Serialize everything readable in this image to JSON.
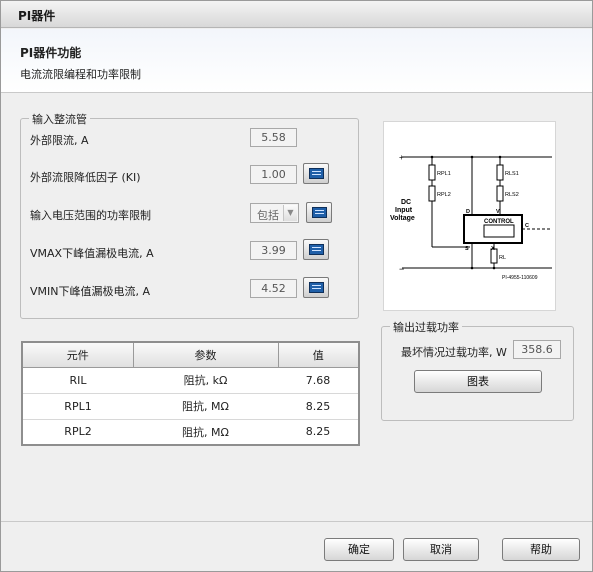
{
  "window": {
    "title": "PI器件"
  },
  "header": {
    "title": "PI器件功能",
    "subtitle": "电流流限编程和功率限制"
  },
  "input_group": {
    "legend": "输入整流管",
    "rows": [
      {
        "label": "外部限流, A",
        "value": "5.58"
      },
      {
        "label": "外部流限降低因子 (KI)",
        "value": "1.00"
      },
      {
        "label": "输入电压范围的功率限制",
        "select_value": "包括"
      },
      {
        "label": "VMAX下峰值漏极电流, A",
        "value": "3.99"
      },
      {
        "label": "VMIN下峰值漏极电流, A",
        "value": "4.52"
      }
    ]
  },
  "table": {
    "headers": [
      "元件",
      "参数",
      "值"
    ],
    "rows": [
      [
        "RIL",
        "阻抗, kΩ",
        "7.68"
      ],
      [
        "RPL1",
        "阻抗, MΩ",
        "8.25"
      ],
      [
        "RPL2",
        "阻抗, MΩ",
        "8.25"
      ]
    ]
  },
  "diagram": {
    "labels": {
      "dc": "DC",
      "input": "Input",
      "voltage": "Voltage",
      "plus": "+",
      "minus": "−",
      "rpl1": "RPL1",
      "rpl2": "RPL2",
      "rls1": "RLS1",
      "rls2": "RLS2",
      "rl": "RL",
      "d": "D",
      "v": "V",
      "c": "C",
      "s": "S",
      "x": "X",
      "control": "CONTROL",
      "code": "PI-4955-110609"
    }
  },
  "output_group": {
    "legend": "输出过载功率",
    "label": "最坏情况过载功率, W",
    "value": "358.6",
    "chart_button": "图表"
  },
  "footer": {
    "ok": "确定",
    "cancel": "取消",
    "help": "帮助"
  }
}
